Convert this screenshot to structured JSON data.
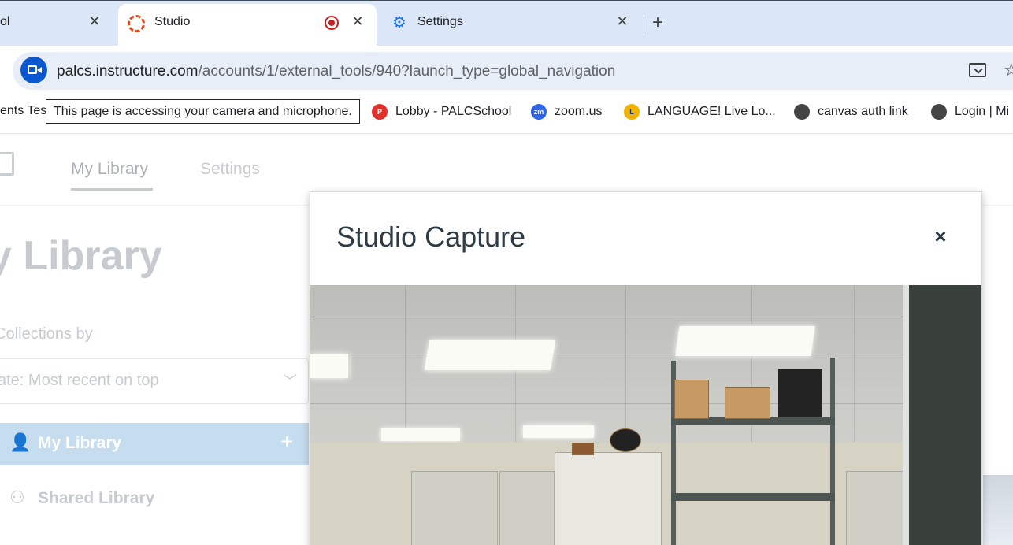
{
  "browser": {
    "tabs": [
      {
        "title": "ol",
        "close": "✕"
      },
      {
        "title": "Studio",
        "close": "✕",
        "recording": true
      },
      {
        "title": "Settings",
        "close": "✕"
      }
    ],
    "new_tab": "+",
    "url_host": "palcs.instructure.com",
    "url_path": "/accounts/1/external_tools/940?launch_type=global_navigation",
    "tooltip": "This page is accessing your camera and microphone.",
    "bookmarks": [
      {
        "label": "ents Tes",
        "icon": "globe-icon"
      },
      {
        "label": "Lobby - PALCSchool",
        "icon": "p-icon"
      },
      {
        "label": "zoom.us",
        "icon": "zoom-icon"
      },
      {
        "label": "LANGUAGE! Live Lo...",
        "icon": "language-live-icon"
      },
      {
        "label": "canvas auth link",
        "icon": "globe-icon"
      },
      {
        "label": "Login | Mi",
        "icon": "globe-icon"
      }
    ]
  },
  "page": {
    "nav": {
      "my_library": "My Library",
      "settings": "Settings"
    },
    "heading": "y Library",
    "sort_label": ": Collections by",
    "sort_value": "ate: Most recent on top",
    "sidebar": [
      {
        "label": "My Library",
        "active": true
      },
      {
        "label": "Shared Library",
        "active": false
      }
    ],
    "add_symbol": "+"
  },
  "modal": {
    "title": "Studio Capture",
    "close": "×"
  },
  "colors": {
    "tabstrip": "#dbe6f7",
    "accent": "#0b57d0",
    "record": "#c5221f",
    "sidebar_active": "#c6dcef"
  }
}
